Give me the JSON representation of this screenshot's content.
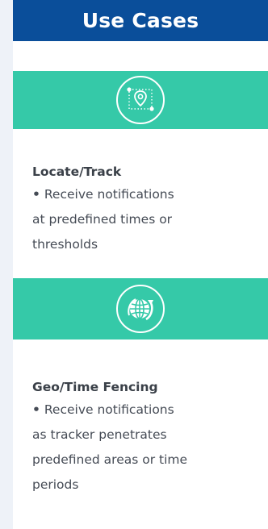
{
  "header": {
    "title": "Use Cases"
  },
  "sections": [
    {
      "icon": "location-pin-area-icon",
      "title": "Locate/Track",
      "bullet": "•",
      "body_lines": [
        "Receive notifications",
        "at predefined times or",
        "thresholds"
      ]
    },
    {
      "icon": "globe-arrow-icon",
      "title": "Geo/Time Fencing",
      "bullet": "•",
      "body_lines": [
        "Receive notifications",
        "as tracker penetrates",
        "predefined areas or time",
        "periods"
      ]
    }
  ],
  "colors": {
    "header_bg": "#0a4e9a",
    "band_bg": "#35c9a8",
    "page_bg": "#eef2f8",
    "text": "#3a4048"
  }
}
